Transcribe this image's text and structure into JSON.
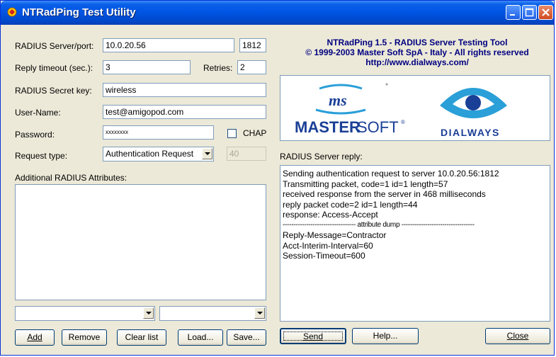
{
  "window": {
    "title": "NTRadPing Test Utility"
  },
  "form": {
    "server_label": "RADIUS Server/port:",
    "server_value": "10.0.20.56",
    "port_value": "1812",
    "timeout_label": "Reply timeout (sec.):",
    "timeout_value": "3",
    "retries_label": "Retries:",
    "retries_value": "2",
    "secret_label": "RADIUS Secret key:",
    "secret_value": "wireless",
    "username_label": "User-Name:",
    "username_value": "test@amigopod.com",
    "password_label": "Password:",
    "password_value": "xxxxxxxx",
    "chap_label": "CHAP",
    "request_type_label": "Request type:",
    "request_type_value": "Authentication Request",
    "request_num_value": "40",
    "attributes_label": "Additional RADIUS Attributes:"
  },
  "header": {
    "line1": "NTRadPing 1.5 - RADIUS Server Testing Tool",
    "line2": "© 1999-2003 Master Soft SpA - Italy - All rights reserved",
    "line3": "http://www.dialways.com/"
  },
  "logos": {
    "ms": "ms",
    "mastersoft_a": "MASTER",
    "mastersoft_b": "SOFT",
    "dialways": "DIALWAYS"
  },
  "reply": {
    "label": "RADIUS Server reply:",
    "lines": [
      "Sending authentication request to server 10.0.20.56:1812",
      "Transmitting packet, code=1 id=1 length=57",
      "received response from the server in 468 milliseconds",
      "reply packet code=2 id=1 length=44",
      "response: Access-Accept",
      "---------------------------------- attribute dump ----------------------------------",
      "Reply-Message=Contractor",
      "Acct-Interim-Interval=60",
      "Session-Timeout=600"
    ]
  },
  "buttons": {
    "add": "Add",
    "remove": "Remove",
    "clear": "Clear list",
    "load": "Load...",
    "save": "Save...",
    "send": "Send",
    "help": "Help...",
    "close": "Close"
  },
  "colors": {
    "title_blue": "#0054e3",
    "header_text": "#000080",
    "logo_blue": "#1a3f96",
    "logo_cyan": "#2a9fd8"
  }
}
